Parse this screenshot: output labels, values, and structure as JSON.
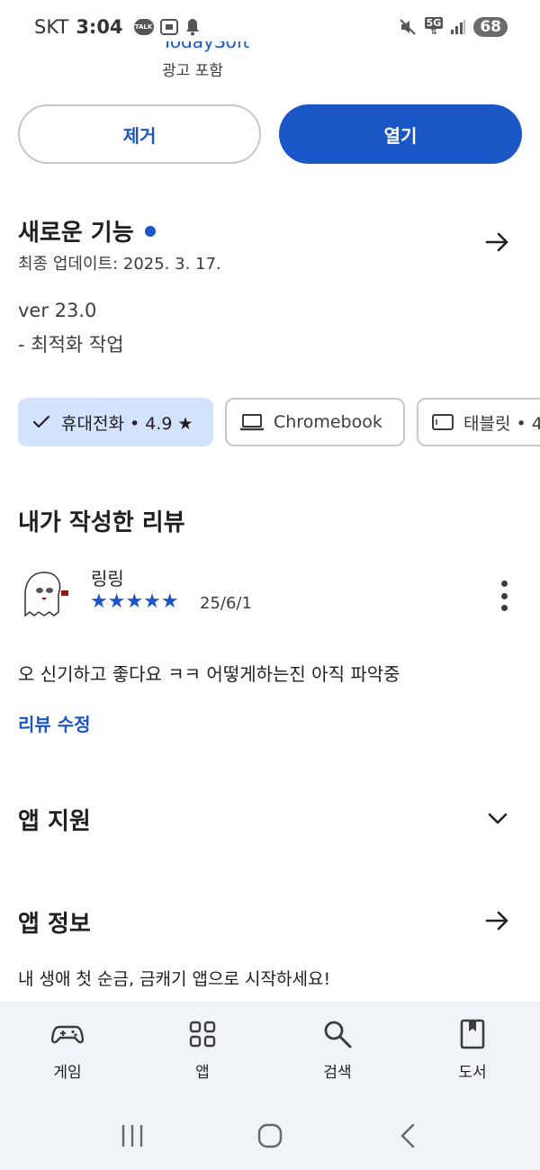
{
  "status_bar": {
    "carrier": "SKT",
    "time": "3:04",
    "talk_badge": "TALK",
    "network": "5G",
    "battery": "68"
  },
  "header": {
    "developer_partial": "TodaySoft",
    "ad_notice": "광고 포함"
  },
  "actions": {
    "remove_label": "제거",
    "open_label": "열기"
  },
  "whats_new": {
    "title": "새로운 기능",
    "updated": "최종 업데이트: 2025. 3. 17.",
    "version": "ver 23.0",
    "notes": "- 최적화 작업"
  },
  "device_chips": [
    {
      "label": "휴대전화 • 4.9 ★",
      "selected": true,
      "icon": "check-icon"
    },
    {
      "label": "Chromebook",
      "selected": false,
      "icon": "laptop-icon"
    },
    {
      "label": "태블릿 • 4",
      "selected": false,
      "icon": "tablet-icon"
    }
  ],
  "my_review": {
    "section_title": "내가 작성한 리뷰",
    "reviewer": "링링",
    "rating": 5,
    "stars": "★★★★★",
    "date": "25/6/1",
    "text": "오 신기하고 좋다요 ㅋㅋ 어떻게하는진 아직 파악중",
    "edit_label": "리뷰 수정"
  },
  "app_support": {
    "title": "앱 지원"
  },
  "app_info": {
    "title": "앱 정보",
    "description": "내 생애 첫 순금, 금캐기 앱으로 시작하세요!"
  },
  "bottom_nav": {
    "items": [
      {
        "label": "게임",
        "icon": "gamepad-icon"
      },
      {
        "label": "앱",
        "icon": "apps-grid-icon"
      },
      {
        "label": "검색",
        "icon": "search-icon"
      },
      {
        "label": "도서",
        "icon": "book-icon"
      }
    ]
  },
  "colors": {
    "accent": "#1a56c5",
    "chip_selected_bg": "#d3e3fd",
    "nav_bg": "#f0f4f9"
  }
}
